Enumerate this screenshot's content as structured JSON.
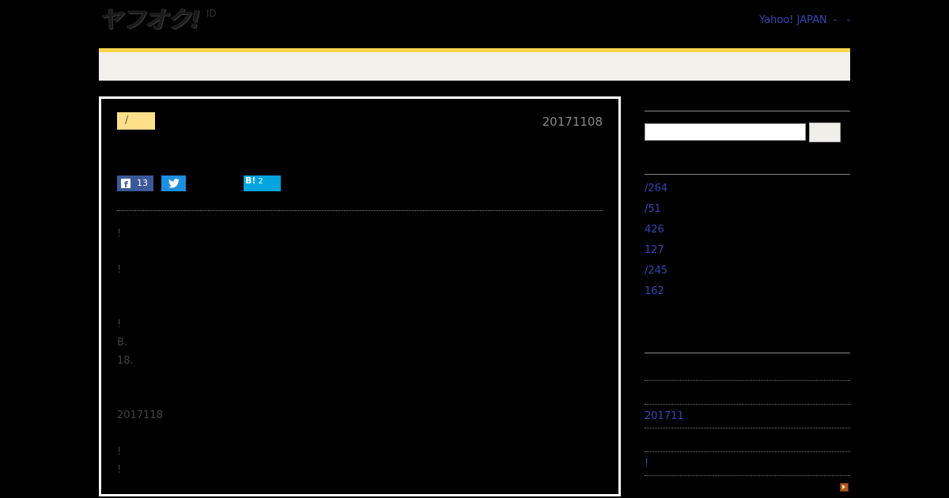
{
  "header": {
    "logo_text": "ヤフオク!",
    "logo_id": "ID",
    "top_link": "Yahoo! JAPAN",
    "top_sep1": "-",
    "top_sep2": "-"
  },
  "article": {
    "category": "/",
    "date": "20171108",
    "share": {
      "facebook_count": "13",
      "hatena_label": "B!",
      "hatena_count": "2"
    },
    "lines": [
      "!",
      "!",
      "!",
      "B.",
      "18.",
      "2017118",
      "!",
      "!"
    ]
  },
  "sidebar": {
    "links": [
      "/264",
      "/51",
      "426",
      "127",
      "/245",
      "162"
    ],
    "archive_link": "201711",
    "misc_link": "!"
  },
  "colors": {
    "accent_yellow": "#f7d54a",
    "link_blue": "#3447b5",
    "facebook": "#3b5998",
    "twitter": "#1d8fe0",
    "hatena": "#00a4de"
  }
}
